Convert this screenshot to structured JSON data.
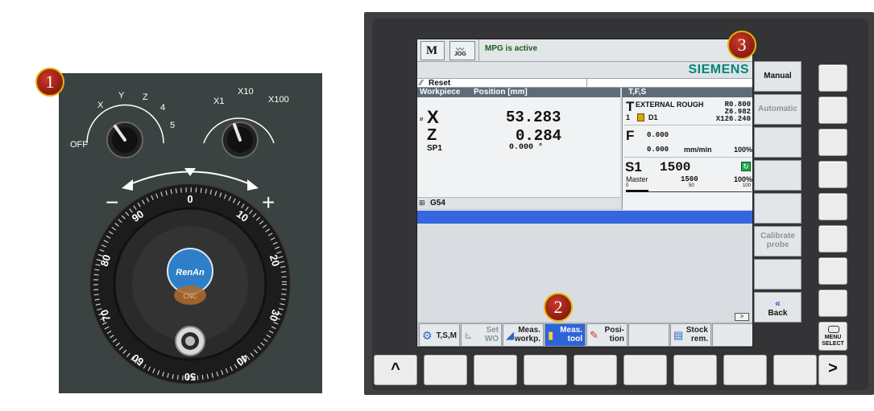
{
  "markers": [
    "1",
    "2",
    "3"
  ],
  "mpg": {
    "selector_labels": [
      "OFF",
      "X",
      "Y",
      "Z",
      "4",
      "5"
    ],
    "multiplier_labels": [
      "X1",
      "X10",
      "X100"
    ],
    "minus": "−",
    "plus": "+",
    "dial_numbers": [
      "0",
      "10",
      "20",
      "30",
      "40",
      "50",
      "60",
      "70",
      "80",
      "90"
    ],
    "logo_text": "RenAn",
    "logo_sub": "CNC"
  },
  "screen": {
    "mode_icon": "M",
    "jog_icon": "JOG",
    "status_message": "MPG is active",
    "brand": "SIEMENS",
    "channel_state": "Reset",
    "position_header": {
      "col1": "Workpiece",
      "col2": "Position [mm]"
    },
    "axes": [
      {
        "name": "X",
        "value": "53.283"
      },
      {
        "name": "Z",
        "value": "0.284"
      }
    ],
    "spindle": {
      "name": "SP1",
      "value": "0.000 °"
    },
    "frame": "G54",
    "tfs": {
      "header": "T,F,S",
      "tool_letter": "T",
      "tool_name": "EXTERNAL ROUGH",
      "tool_radius": "R0.800",
      "tool_z": "Z6.982",
      "tool_x": "X126.240",
      "tool_number": "1",
      "tool_edge": "D1",
      "feed_letter": "F",
      "feed_value1": "0.000",
      "feed_value2": "0.000",
      "feed_unit": "mm/min",
      "feed_override": "100%",
      "spindle_letter": "S1",
      "spindle_speed": "1500",
      "spindle_master": "Master",
      "spindle_master_value": "1500",
      "spindle_override": "100%",
      "scale": [
        "0",
        "50",
        "100"
      ]
    },
    "arrow_indicator": ">",
    "horizontal_softkeys": [
      {
        "label": "T,S,M",
        "active": false
      },
      {
        "label": "Set\nWO",
        "active": false
      },
      {
        "label": "Meas.\nworkp.",
        "active": false
      },
      {
        "label": "Meas.\ntool",
        "active": true
      },
      {
        "label": "Posi-\ntion",
        "active": false
      },
      {
        "label": "",
        "active": false
      },
      {
        "label": "Stock\nrem.",
        "active": false
      },
      {
        "label": "",
        "active": false
      }
    ],
    "vertical_softkeys": [
      {
        "label": "Manual",
        "dim": false
      },
      {
        "label": "Automatic",
        "dim": true
      },
      {
        "label": "",
        "dim": false
      },
      {
        "label": "",
        "dim": false
      },
      {
        "label": "",
        "dim": false
      },
      {
        "label": "Calibrate\nprobe",
        "dim": true
      },
      {
        "label": "",
        "dim": false
      },
      {
        "label": "Back",
        "dim": false
      }
    ]
  },
  "panel_keys": {
    "back_arrow": "^",
    "forward_arrow": ">",
    "menu_select": "MENU\nSELECT"
  },
  "colors": {
    "active_softkey": "#2f63d8",
    "siemens_teal": "#00857a",
    "marker_red": "#a32618",
    "marker_ring": "#e8b400"
  }
}
